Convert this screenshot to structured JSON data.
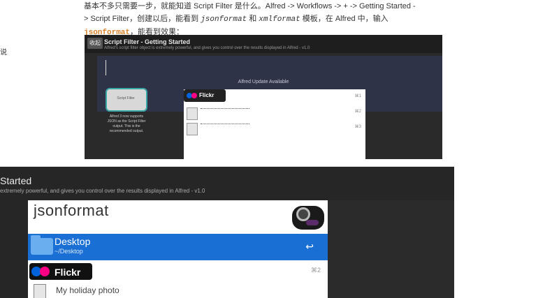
{
  "article": {
    "line1": "基本不多只需要一步，就能知道 Script Filter 是什么。Alfred -> Workflows -> + -> Getting Started -",
    "line2_prefix": "> Script Filter，创建以后，能看到 ",
    "line2_jsonformat": "jsonformat",
    "line2_and": " 和 ",
    "line2_xmlformat": "xmlformat",
    "line2_suffix": " 模板，在 Alfred 中，输入",
    "line3_code": "jsonformat",
    "line3_suffix": "，能看到效果："
  },
  "left_fragment": "说",
  "screenshot_top": {
    "collapse_button": "收起",
    "title": "Script Filter - Getting Started",
    "subtitle": "Alfred's script filter object is extremely powerful, and gives you control over the results displayed in Alfred - v1.0",
    "update_notice": "Alfred Update Available",
    "script_filter_card": {
      "icon_label": "Script Filter",
      "text": "Alfred 3 now supports JSON as the Script Filter output. This is the recommended output."
    },
    "mini_results": {
      "badge_label": "Flickr",
      "rows": [
        {
          "shortcut": "⌘1"
        },
        {
          "shortcut": "⌘2"
        },
        {
          "shortcut": "⌘3"
        }
      ]
    }
  },
  "screenshot_bottom": {
    "title": "Started",
    "subtitle": "extremely powerful, and gives you control over the results displayed in Alfred - v1.0",
    "query": "jsonformat",
    "selected_result": {
      "title": "Desktop",
      "subtitle": "~/Desktop",
      "action_glyph": "↩"
    },
    "flickr_label": "Flickr",
    "flickr_shortcut": "⌘2",
    "file_result": "My holiday photo"
  },
  "colors": {
    "accent_code": "#d9822b",
    "selection_blue": "#1a6fd4",
    "flickr_blue": "#0063dc",
    "flickr_pink": "#ff0084"
  }
}
